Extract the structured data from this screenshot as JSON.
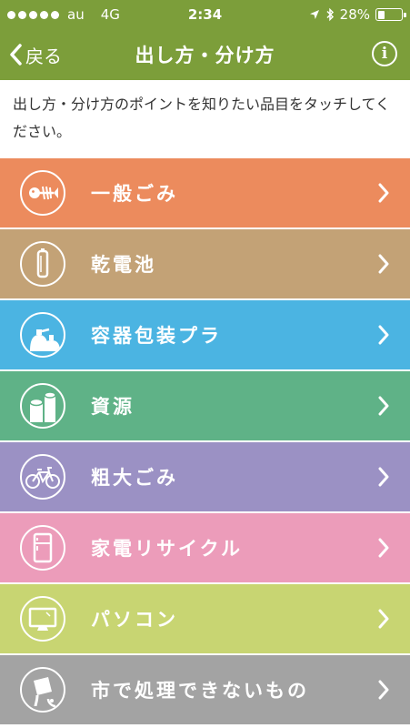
{
  "status": {
    "carrier": "au",
    "network": "4G",
    "time": "2:34",
    "battery": "28%",
    "battery_level": 0.28
  },
  "nav": {
    "back_label": "戻る",
    "title": "出し方・分け方",
    "info_glyph": "i"
  },
  "instruction": "出し方・分け方のポイントを知りたい品目をタッチしてください。",
  "categories": [
    {
      "label": "一般ごみ",
      "color": "#ec8b5d",
      "icon": "fish-bone-icon"
    },
    {
      "label": "乾電池",
      "color": "#c3a276",
      "icon": "battery-cell-icon"
    },
    {
      "label": "容器包装プラ",
      "color": "#4bb4e2",
      "icon": "plastic-bottles-icon"
    },
    {
      "label": "資源",
      "color": "#5fb287",
      "icon": "paper-rolls-icon"
    },
    {
      "label": "粗大ごみ",
      "color": "#9b91c4",
      "icon": "bicycle-icon"
    },
    {
      "label": "家電リサイクル",
      "color": "#ec9cba",
      "icon": "refrigerator-icon"
    },
    {
      "label": "パソコン",
      "color": "#c8d572",
      "icon": "computer-monitor-icon"
    },
    {
      "label": "市で処理できないもの",
      "color": "#a3a3a3",
      "icon": "paint-can-icon"
    }
  ]
}
